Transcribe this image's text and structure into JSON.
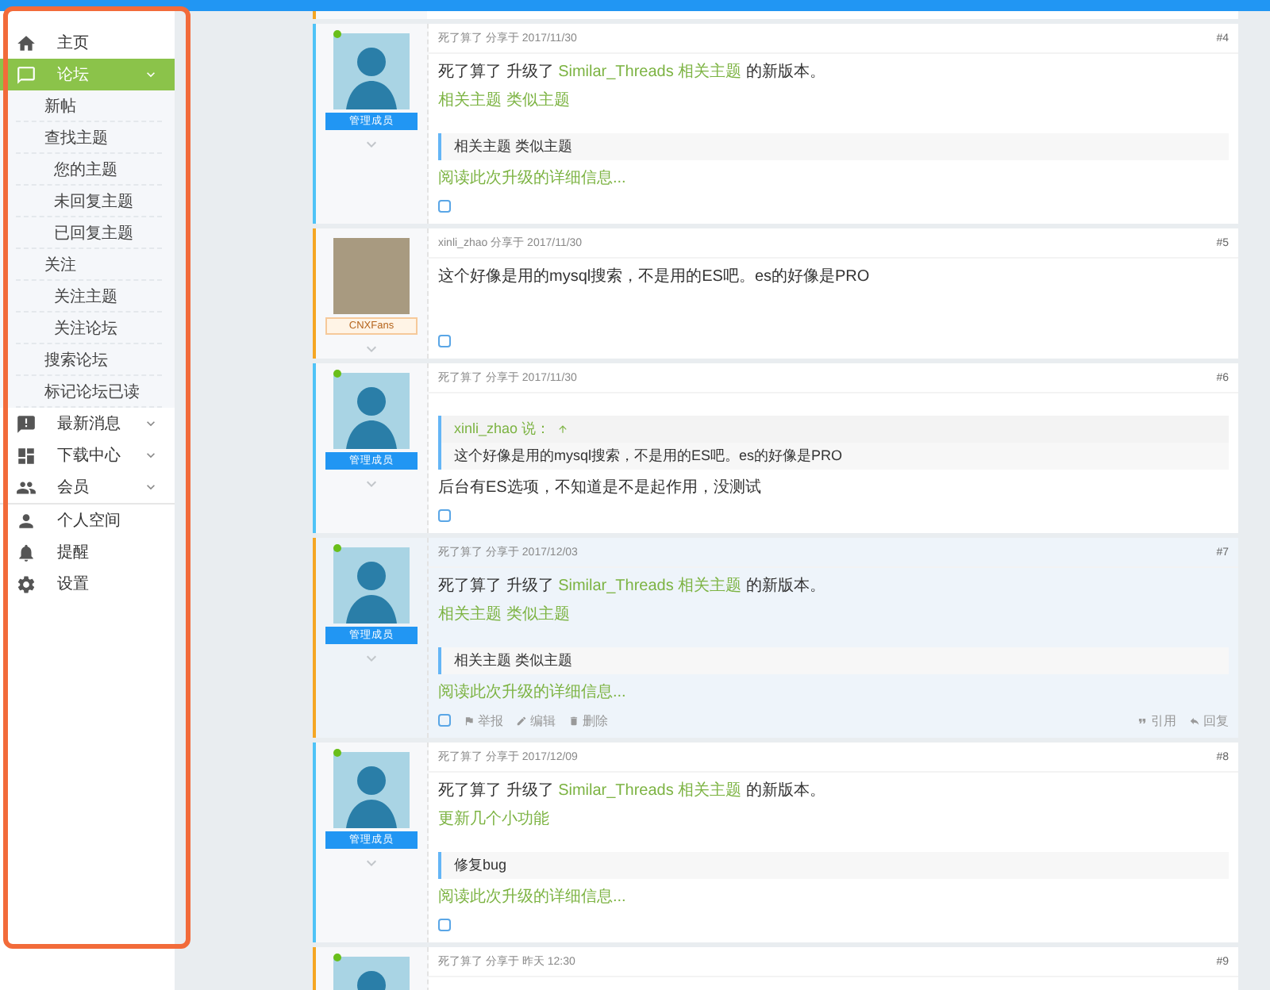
{
  "sidebar": {
    "sections": [
      [
        {
          "label": "主页",
          "kind": "link",
          "selected": false
        },
        {
          "label": "论坛",
          "kind": "menu",
          "selected": true,
          "expanded": true,
          "children": [
            {
              "label": "新帖"
            },
            {
              "label": "查找主题",
              "children": [
                {
                  "label": "您的主题"
                },
                {
                  "label": "未回复主题"
                },
                {
                  "label": "已回复主题"
                }
              ]
            },
            {
              "label": "关注",
              "children": [
                {
                  "label": "关注主题"
                },
                {
                  "label": "关注论坛"
                }
              ]
            },
            {
              "label": "搜索论坛"
            },
            {
              "label": "标记论坛已读"
            }
          ]
        },
        {
          "label": "最新消息",
          "kind": "menu",
          "selected": false
        },
        {
          "label": "下载中心",
          "kind": "menu",
          "selected": false
        },
        {
          "label": "会员",
          "kind": "menu",
          "selected": false
        }
      ],
      [
        {
          "label": "个人空间",
          "kind": "link",
          "selected": false
        },
        {
          "label": "提醒",
          "kind": "link",
          "selected": false
        },
        {
          "label": "设置",
          "kind": "link",
          "selected": false
        }
      ]
    ]
  },
  "posts": [
    {
      "number": "#4",
      "author": "死了算了",
      "shared": "分享于",
      "date": "2017/11/30",
      "color": "#4fc3f7",
      "avatar": {
        "kind": "illustration"
      },
      "online": true,
      "badge": {
        "text": "管理成员",
        "kind": "staff"
      },
      "highlighted": false,
      "body": [
        {
          "kind": "text",
          "parts": [
            {
              "text": "死了算了 升级了 ",
              "link": false
            },
            {
              "text": "Similar_Threads 相关主题",
              "link": true
            },
            {
              "text": " 的新版本。",
              "link": false
            }
          ]
        },
        {
          "kind": "link",
          "text": "相关主题 类似主题"
        },
        {
          "kind": "quote",
          "text": "相关主题 类似主题"
        },
        {
          "kind": "link",
          "text": "阅读此次升级的详细信息..."
        }
      ]
    },
    {
      "number": "#5",
      "author": "xinli_zhao",
      "shared": "分享于",
      "date": "2017/11/30",
      "color": "#f5a623",
      "avatar": {
        "kind": "photo"
      },
      "online": false,
      "badge": {
        "text": "CNXFans",
        "kind": "member"
      },
      "highlighted": false,
      "body": [
        {
          "kind": "text",
          "parts": [
            {
              "text": "这个好像是用的mysql搜索，不是用的ES吧。es的好像是PRO",
              "link": false
            }
          ]
        }
      ]
    },
    {
      "number": "#6",
      "author": "死了算了",
      "shared": "分享于",
      "date": "2017/11/30",
      "color": "#4fc3f7",
      "avatar": {
        "kind": "illustration"
      },
      "online": true,
      "badge": {
        "text": "管理成员",
        "kind": "staff"
      },
      "highlighted": false,
      "body": [
        {
          "kind": "quote",
          "author": "xinli_zhao 说：",
          "text": "这个好像是用的mysql搜索，不是用的ES吧。es的好像是PRO"
        },
        {
          "kind": "text",
          "parts": [
            {
              "text": "后台有ES选项，不知道是不是起作用，没测试",
              "link": false
            }
          ]
        }
      ]
    },
    {
      "number": "#7",
      "author": "死了算了",
      "shared": "分享于",
      "date": "2017/12/03",
      "color": "#f5a623",
      "avatar": {
        "kind": "illustration"
      },
      "online": true,
      "badge": {
        "text": "管理成员",
        "kind": "staff"
      },
      "highlighted": true,
      "body": [
        {
          "kind": "text",
          "parts": [
            {
              "text": "死了算了 升级了 ",
              "link": false
            },
            {
              "text": "Similar_Threads 相关主题",
              "link": true
            },
            {
              "text": " 的新版本。",
              "link": false
            }
          ]
        },
        {
          "kind": "link",
          "text": "相关主题 类似主题"
        },
        {
          "kind": "quote",
          "text": "相关主题 类似主题"
        },
        {
          "kind": "link",
          "text": "阅读此次升级的详细信息..."
        }
      ],
      "actions": [
        "举报",
        "编辑",
        "删除"
      ],
      "reply_actions": [
        "引用",
        "回复"
      ]
    },
    {
      "number": "#8",
      "author": "死了算了",
      "shared": "分享于",
      "date": "2017/12/09",
      "color": "#4fc3f7",
      "avatar": {
        "kind": "illustration"
      },
      "online": true,
      "badge": {
        "text": "管理成员",
        "kind": "staff"
      },
      "highlighted": false,
      "body": [
        {
          "kind": "text",
          "parts": [
            {
              "text": "死了算了 升级了 ",
              "link": false
            },
            {
              "text": "Similar_Threads 相关主题",
              "link": true
            },
            {
              "text": " 的新版本。",
              "link": false
            }
          ]
        },
        {
          "kind": "link",
          "text": "更新几个小功能"
        },
        {
          "kind": "quote",
          "text": "修复bug"
        },
        {
          "kind": "link",
          "text": "阅读此次升级的详细信息..."
        }
      ]
    },
    {
      "number": "#9",
      "author": "死了算了",
      "shared": "分享于",
      "date": "昨天 12:30",
      "color": "#f5a623",
      "avatar": {
        "kind": "illustration"
      },
      "online": true,
      "highlighted": false
    }
  ]
}
